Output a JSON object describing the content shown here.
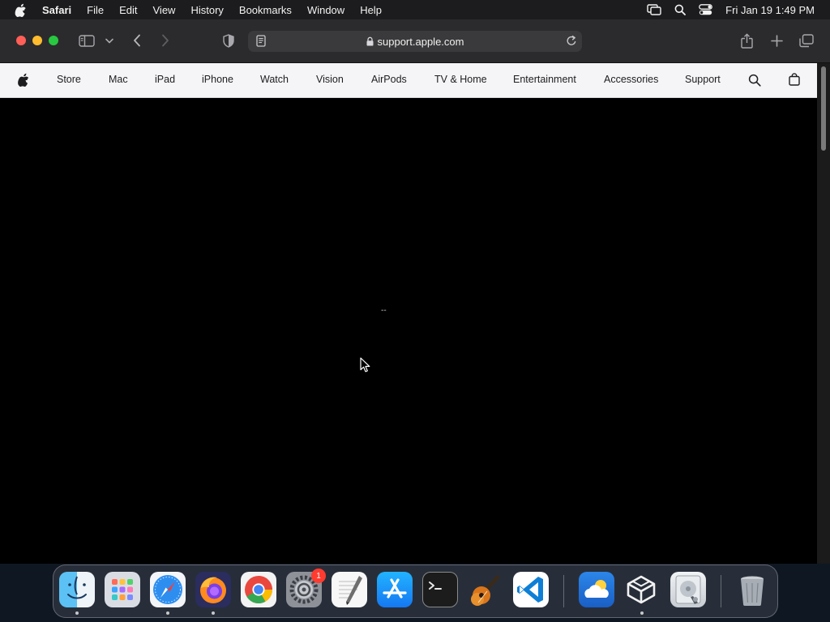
{
  "menubar": {
    "apple_icon": "apple-logo-icon",
    "items": [
      {
        "label": "Safari",
        "bold": true
      },
      {
        "label": "File"
      },
      {
        "label": "Edit"
      },
      {
        "label": "View"
      },
      {
        "label": "History"
      },
      {
        "label": "Bookmarks"
      },
      {
        "label": "Window"
      },
      {
        "label": "Help"
      }
    ],
    "status_icons": [
      "screen-mirroring-icon",
      "spotlight-search-icon",
      "control-center-icon"
    ],
    "clock": "Fri Jan 19  1:49 PM"
  },
  "toolbar": {
    "address": "support.apple.com",
    "icons": [
      "sidebar-icon",
      "chevron-down-icon",
      "back-icon",
      "forward-icon",
      "privacy-shield-icon",
      "reader-icon",
      "lock-icon",
      "reload-icon",
      "share-icon",
      "new-tab-icon",
      "tab-overview-icon"
    ]
  },
  "globalnav": {
    "items": [
      "Store",
      "Mac",
      "iPad",
      "iPhone",
      "Watch",
      "Vision",
      "AirPods",
      "TV & Home",
      "Entertainment",
      "Accessories",
      "Support"
    ],
    "icons": [
      "apple-logo-icon",
      "search-icon",
      "bag-icon"
    ]
  },
  "page": {
    "text": "--"
  },
  "dock": {
    "apps": [
      "Finder",
      "Launchpad",
      "Safari",
      "Firefox",
      "Google Chrome",
      "System Settings",
      "TextEdit",
      "App Store",
      "Terminal",
      "GarageBand",
      "Visual Studio Code",
      "Weather",
      "Perplexity",
      "Disk Utility",
      "Trash"
    ],
    "settings_badge": "1"
  },
  "colors": {
    "menubar_bg": "#1c1c1e",
    "toolbar_bg": "#2b2b2d",
    "globalnav_bg": "#f5f5f7",
    "page_bg": "#000000",
    "close": "#ff5f57",
    "minimize": "#febc2e",
    "zoom": "#28c840",
    "badge": "#ff3b30"
  }
}
